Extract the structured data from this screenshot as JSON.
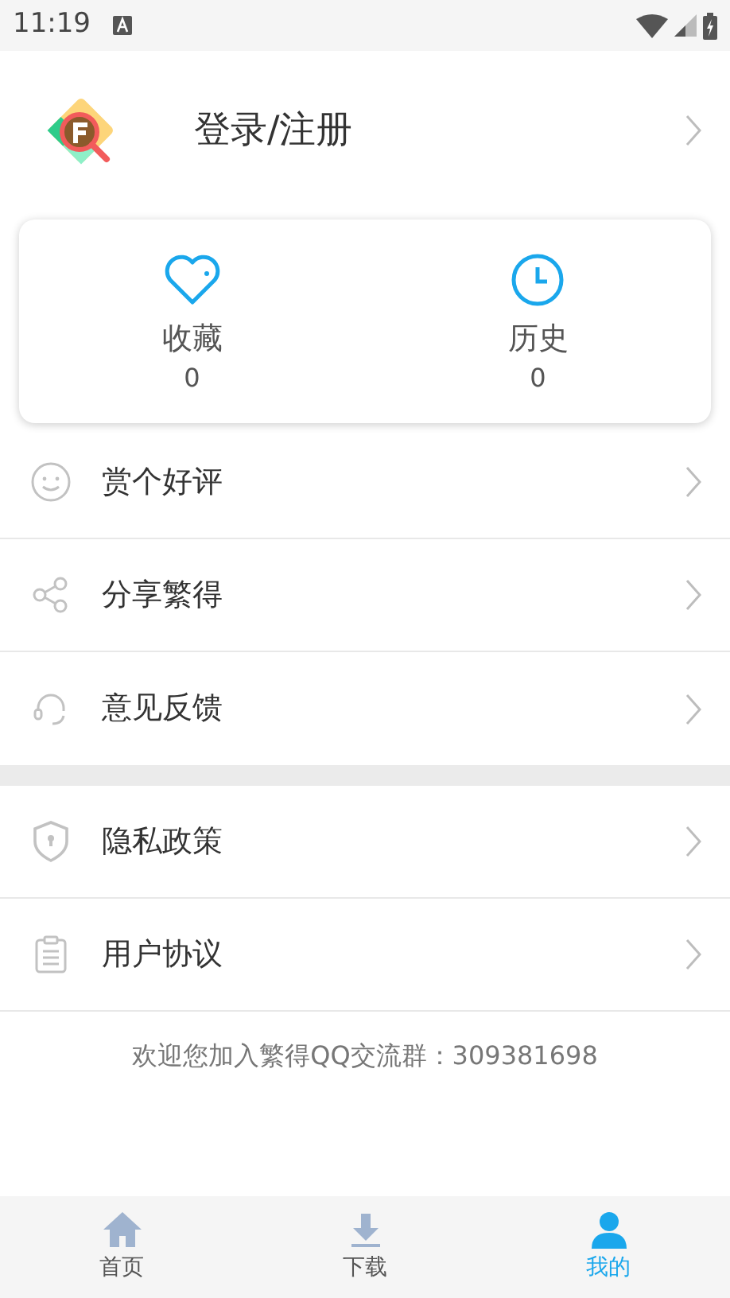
{
  "status_bar": {
    "time": "11:19"
  },
  "profile": {
    "label": "登录/注册"
  },
  "stats": [
    {
      "kind": "heart",
      "label": "收藏",
      "count": "0"
    },
    {
      "kind": "clock",
      "label": "历史",
      "count": "0"
    }
  ],
  "menu_groups": [
    [
      {
        "kind": "smile",
        "label": "赏个好评"
      },
      {
        "kind": "share",
        "label": "分享繁得"
      },
      {
        "kind": "headset",
        "label": "意见反馈"
      }
    ],
    [
      {
        "kind": "shield",
        "label": "隐私政策"
      },
      {
        "kind": "clipboard",
        "label": "用户协议"
      }
    ]
  ],
  "footer": "欢迎您加入繁得QQ交流群：309381698",
  "tabs": [
    {
      "kind": "home",
      "label": "首页",
      "selected": false
    },
    {
      "kind": "download",
      "label": "下载",
      "selected": false
    },
    {
      "kind": "user",
      "label": "我的",
      "selected": true
    }
  ]
}
